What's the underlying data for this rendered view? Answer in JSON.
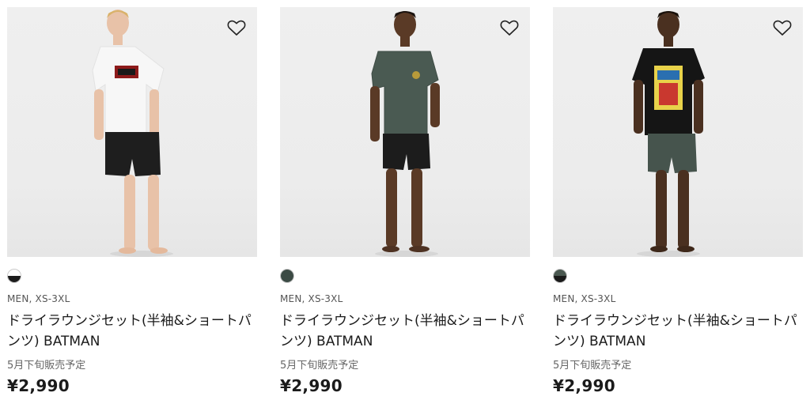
{
  "products": [
    {
      "meta": "MEN, XS-3XL",
      "name": "ドライラウンジセット(半袖&ショートパンツ) BATMAN",
      "note": "5月下旬販売予定",
      "price": "¥2,990",
      "swatch_top": "#ffffff",
      "swatch_bottom": "#1c1c1c",
      "shirt_color": "#f7f7f7",
      "shorts_color": "#1e1e1e",
      "print": "batman-logo"
    },
    {
      "meta": "MEN, XS-3XL",
      "name": "ドライラウンジセット(半袖&ショートパンツ) BATMAN",
      "note": "5月下旬販売予定",
      "price": "¥2,990",
      "swatch_top": "#3b4a44",
      "swatch_bottom": "#3b4a44",
      "shirt_color": "#4a5a52",
      "shorts_color": "#1c1c1c",
      "print": "small-chest-logo"
    },
    {
      "meta": "MEN, XS-3XL",
      "name": "ドライラウンジセット(半袖&ショートパンツ) BATMAN",
      "note": "5月下旬販売予定",
      "price": "¥2,990",
      "swatch_top": "#4a5850",
      "swatch_bottom": "#1a1a1a",
      "shirt_color": "#151515",
      "shorts_color": "#46544d",
      "print": "comic-cover"
    }
  ],
  "icons": {
    "favorite": "heart-outline-icon"
  }
}
